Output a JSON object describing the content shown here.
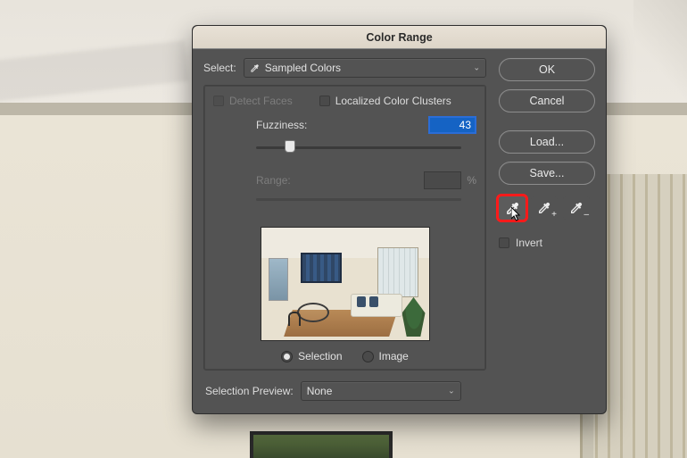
{
  "dialog": {
    "title": "Color Range",
    "select_label": "Select:",
    "select_value": "Sampled Colors",
    "detect_faces_label": "Detect Faces",
    "localized_label": "Localized Color Clusters",
    "fuzziness_label": "Fuzziness:",
    "fuzziness_value": "43",
    "range_label": "Range:",
    "range_unit": "%",
    "radio_selection": "Selection",
    "radio_image": "Image",
    "selection_preview_label": "Selection Preview:",
    "selection_preview_value": "None"
  },
  "buttons": {
    "ok": "OK",
    "cancel": "Cancel",
    "load": "Load...",
    "save": "Save..."
  },
  "invert_label": "Invert",
  "slider": {
    "fuzziness_pct": 14
  }
}
